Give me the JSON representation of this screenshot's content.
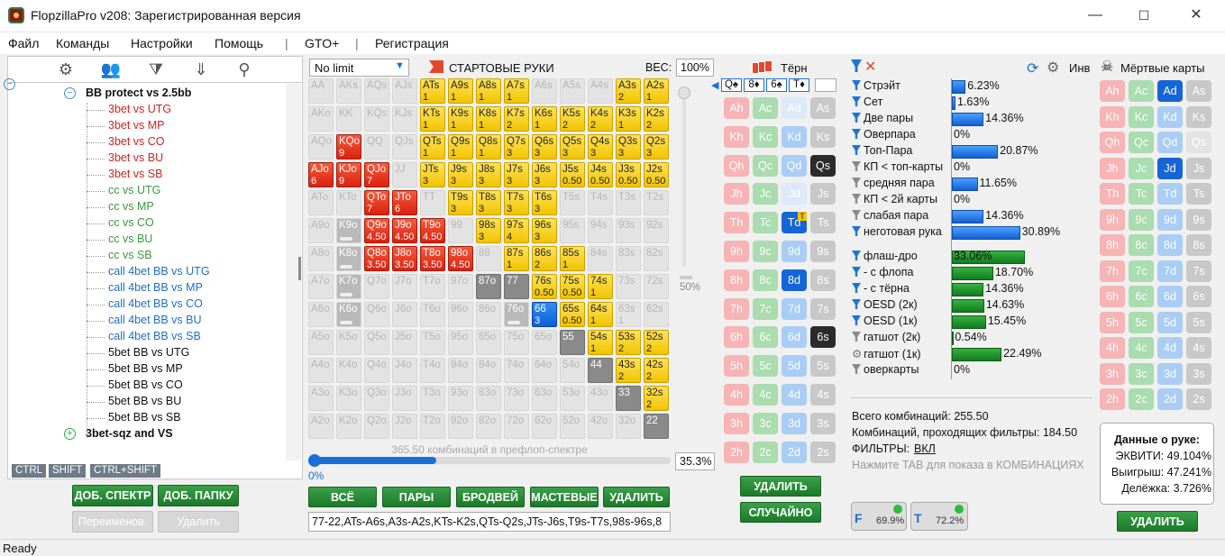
{
  "window": {
    "title": "FlopzillaPro v208: Зарегистрированная версия",
    "min": "—",
    "max": "☐",
    "close": "✕"
  },
  "menu": [
    "Файл",
    "Команды",
    "Настройки",
    "Помощь",
    "|",
    "GTO+",
    "|",
    "Регистрация"
  ],
  "tree": {
    "items": [
      {
        "label": "BB protect vs 2.5bb",
        "color": "#111",
        "bold": true,
        "expander": "−"
      },
      {
        "label": "3bet vs UTG",
        "color": "#d32222"
      },
      {
        "label": "3bet vs MP",
        "color": "#d32222"
      },
      {
        "label": "3bet vs CO",
        "color": "#d32222"
      },
      {
        "label": "3bet vs BU",
        "color": "#d32222"
      },
      {
        "label": "3bet vs SB",
        "color": "#d32222"
      },
      {
        "label": "cc vs UTG",
        "color": "#3a9a3a"
      },
      {
        "label": "cc vs MP",
        "color": "#3a9a3a"
      },
      {
        "label": "cc vs CO",
        "color": "#3a9a3a"
      },
      {
        "label": "cc vs BU",
        "color": "#3a9a3a"
      },
      {
        "label": "cc vs SB",
        "color": "#3a9a3a"
      },
      {
        "label": "call 4bet BB vs UTG",
        "color": "#1f6fc4"
      },
      {
        "label": "call 4bet BB vs MP",
        "color": "#1f6fc4"
      },
      {
        "label": "call 4bet BB vs CO",
        "color": "#1f6fc4"
      },
      {
        "label": "call 4bet BB vs BU",
        "color": "#1f6fc4"
      },
      {
        "label": "call 4bet BB vs SB",
        "color": "#1f6fc4"
      },
      {
        "label": "5bet BB vs UTG",
        "color": "#111"
      },
      {
        "label": "5bet BB vs MP",
        "color": "#111"
      },
      {
        "label": "5bet BB vs CO",
        "color": "#111"
      },
      {
        "label": "5bet BB vs BU",
        "color": "#111"
      },
      {
        "label": "5bet BB vs SB",
        "color": "#111"
      },
      {
        "label": "3bet-sqz and VS",
        "color": "#111",
        "bold": true,
        "expander": "+"
      }
    ]
  },
  "left_tabs": [
    "CTRL",
    "SHIFT",
    "CTRL+SHIFT"
  ],
  "left_buttons": {
    "add_range": "ДОБ. СПЕКТР",
    "add_folder": "ДОБ. ПАПКУ",
    "rename": "Переименов.",
    "delete": "Удалить"
  },
  "range": {
    "mode": "No limit",
    "header": "СТАРТОВЫЕ РУКИ",
    "weight_label": "ВЕС:",
    "weight": "100%",
    "slider_pct": "50%",
    "combos_text": "365.50 комбинаций в префлоп-спектре",
    "progress_left": "0%",
    "progress_pct": "35.3%",
    "progress": 0.353,
    "grid": [
      [
        "AA",
        "AKs",
        "AQs",
        "AJs",
        "ATs",
        "A9s",
        "A8s",
        "A7s",
        "A6s",
        "A5s",
        "A4s",
        "A3s",
        "A2s"
      ],
      [
        "AKo",
        "KK",
        "KQs",
        "KJs",
        "KTs",
        "K9s",
        "K8s",
        "K7s",
        "K6s",
        "K5s",
        "K4s",
        "K3s",
        "K2s"
      ],
      [
        "AQo",
        "KQo",
        "QQ",
        "QJs",
        "QTs",
        "Q9s",
        "Q8s",
        "Q7s",
        "Q6s",
        "Q5s",
        "Q4s",
        "Q3s",
        "Q2s"
      ],
      [
        "AJo",
        "KJo",
        "QJo",
        "JJ",
        "JTs",
        "J9s",
        "J8s",
        "J7s",
        "J6s",
        "J5s",
        "J4s",
        "J3s",
        "J2s"
      ],
      [
        "ATo",
        "KTo",
        "QTo",
        "JTo",
        "TT",
        "T9s",
        "T8s",
        "T7s",
        "T6s",
        "T5s",
        "T4s",
        "T3s",
        "T2s"
      ],
      [
        "A9o",
        "K9o",
        "Q9o",
        "J9o",
        "T9o",
        "99",
        "98s",
        "97s",
        "96s",
        "95s",
        "94s",
        "93s",
        "92s"
      ],
      [
        "A8o",
        "K8o",
        "Q8o",
        "J8o",
        "T8o",
        "98o",
        "88",
        "87s",
        "86s",
        "85s",
        "84s",
        "83s",
        "82s"
      ],
      [
        "A7o",
        "K7o",
        "Q7o",
        "J7o",
        "T7o",
        "97o",
        "87o",
        "77",
        "76s",
        "75s",
        "74s",
        "73s",
        "72s"
      ],
      [
        "A6o",
        "K6o",
        "Q6o",
        "J6o",
        "T6o",
        "96o",
        "86o",
        "76o",
        "66",
        "65s",
        "64s",
        "63s",
        "62s"
      ],
      [
        "A5o",
        "K5o",
        "Q5o",
        "J5o",
        "T5o",
        "95o",
        "85o",
        "75o",
        "65o",
        "55",
        "54s",
        "53s",
        "52s"
      ],
      [
        "A4o",
        "K4o",
        "Q4o",
        "J4o",
        "T4o",
        "94o",
        "84o",
        "74o",
        "64o",
        "54o",
        "44",
        "43s",
        "42s"
      ],
      [
        "A3o",
        "K3o",
        "Q3o",
        "J3o",
        "T3o",
        "93o",
        "83o",
        "73o",
        "63o",
        "53o",
        "43o",
        "33",
        "32s"
      ],
      [
        "A2o",
        "K2o",
        "Q2o",
        "J2o",
        "T2o",
        "92o",
        "82o",
        "72o",
        "62o",
        "52o",
        "42o",
        "32o",
        "22"
      ]
    ],
    "states": [
      "gggg yyyy gggyy",
      "ggggyyyyyyyyy",
      "gr gyyyyyyyyy",
      "rrrgyyyyyyyyy",
      "gdrrgyyyyggggg",
      "gdrrrgyyyggggg",
      "gdrrrgyyyyggg",
      "gdggggdkyyygg",
      "gdggggggbyygg",
      "gggggggggkyyy",
      "gggggggggggkyy",
      "ggggggggggggkyy",
      "ggggggggggggk"
    ],
    "sub": {
      "ATs": "1",
      "A9s": "1",
      "A8s": "1",
      "A7s": "1",
      "A3s": "2",
      "A2s": "1",
      "KTs": "1",
      "K9s": "1",
      "K8s": "1",
      "K7s": "2",
      "K6s": "1",
      "K5s": "2",
      "K4s": "2",
      "K3s": "1",
      "K2s": "2",
      "KQo": "9",
      "QTs": "1",
      "Q9s": "1",
      "Q8s": "1",
      "Q7s": "3",
      "Q6s": "3",
      "Q5s": "3",
      "Q4s": "3",
      "Q3s": "3",
      "Q2s": "3",
      "AJo": "6",
      "KJo": "9",
      "QJo": "7",
      "JTs": "3",
      "J9s": "3",
      "J8s": "3",
      "J7s": "3",
      "J6s": "3",
      "J5s": "0.50",
      "J4s": "0.50",
      "J3s": "0.50",
      "J2s": "0.50",
      "T9s": "3",
      "T8s": "3",
      "T7s": "3",
      "T6s": "3",
      "QTo": "7",
      "JTo": "6",
      "Q9o": "4.50",
      "J9o": "4.50",
      "T9o": "4.50",
      "98s": "3",
      "97s": "4",
      "96s": "3",
      "Q8o": "3.50",
      "J8o": "3.50",
      "T8o": "3.50",
      "98o": "4.50",
      "87s": "1",
      "86s": "2",
      "85s": "1",
      "76s": "0.50",
      "75s": "0.50",
      "74s": "1",
      "66": "3",
      "65s": "0.50",
      "64s": "1",
      "63s": "1",
      "54s": "1",
      "53s": "2",
      "52s": "2",
      "43s": "2",
      "42s": "2",
      "32s": "2"
    },
    "buttons": [
      "ВСЁ",
      "ПАРЫ",
      "БРОДВЕЙ",
      "МАСТЕВЫЕ",
      "УДАЛИТЬ"
    ],
    "hand_text": "77-22,ATs-A6s,A3s-A2s,KTs-K2s,QTs-Q2s,JTs-J6s,T9s-T7s,98s-96s,8"
  },
  "board": {
    "title": "Тёрн",
    "cards": [
      "Q♠",
      "8♦",
      "6♠",
      "T♦"
    ],
    "delete": "УДАЛИТЬ",
    "random": "СЛУЧАЙНО",
    "rows": [
      "A",
      "K",
      "Q",
      "J",
      "T",
      "9",
      "8",
      "7",
      "6",
      "5",
      "4",
      "3",
      "2"
    ],
    "suits": [
      "h",
      "c",
      "d",
      "s"
    ]
  },
  "dead": {
    "title": "Мёртвые карты",
    "inv": "Инв",
    "delete": "УДАЛИТЬ"
  },
  "stats": {
    "rows": [
      {
        "label": "Стрэйт",
        "pct": "6.23%",
        "v": 6.23,
        "f": "b"
      },
      {
        "label": "Сет",
        "pct": "1.63%",
        "v": 1.63,
        "f": "b"
      },
      {
        "label": "Две пары",
        "pct": "14.36%",
        "v": 14.36,
        "f": "b"
      },
      {
        "label": "Оверпара",
        "pct": "0%",
        "v": 0,
        "f": "b"
      },
      {
        "label": "Топ-Пара",
        "pct": "20.87%",
        "v": 20.87,
        "f": "b"
      },
      {
        "label": "КП < топ-карты",
        "pct": "0%",
        "v": 0,
        "f": "g"
      },
      {
        "label": "средняя пара",
        "pct": "11.65%",
        "v": 11.65,
        "f": "g"
      },
      {
        "label": "КП < 2й карты",
        "pct": "0%",
        "v": 0,
        "f": "g"
      },
      {
        "label": "слабая пара",
        "pct": "14.36%",
        "v": 14.36,
        "f": "g"
      },
      {
        "label": "неготовая рука",
        "pct": "30.89%",
        "v": 30.89,
        "f": "b"
      }
    ],
    "draws": [
      {
        "label": "флаш-дро",
        "pct": "33.06%",
        "v": 33.06,
        "f": "b"
      },
      {
        "label": "- с флопа",
        "pct": "18.70%",
        "v": 18.7,
        "f": "b"
      },
      {
        "label": "- с тёрна",
        "pct": "14.36%",
        "v": 14.36,
        "f": "b"
      },
      {
        "label": "OESD (2к)",
        "pct": "14.63%",
        "v": 14.63,
        "f": "b"
      },
      {
        "label": "OESD (1к)",
        "pct": "15.45%",
        "v": 15.45,
        "f": "b"
      },
      {
        "label": "гатшот (2к)",
        "pct": "0.54%",
        "v": 0.54,
        "f": "g"
      },
      {
        "label": "гатшот (1к)",
        "pct": "22.49%",
        "v": 22.49,
        "f": "gear"
      },
      {
        "label": "оверкарты",
        "pct": "0%",
        "v": 0,
        "f": "g"
      }
    ],
    "total": "Всего комбинаций: 255.50",
    "passing": "Комбинаций, проходящих фильтры: 184.50",
    "filters_label": "ФИЛЬТРЫ:",
    "filters_val": "ВКЛ",
    "hint": "Нажмите TAB для показа в КОМБИНАЦИЯХ",
    "f_pct": "69.9%",
    "t_pct": "72.2%"
  },
  "hand_data": {
    "title": "Данные о руке:",
    "equity": "ЭКВИТИ: 49.104%",
    "win": "Выигрыш: 47.241%",
    "split": "Делёжка: 3.726%"
  },
  "status": "Ready"
}
